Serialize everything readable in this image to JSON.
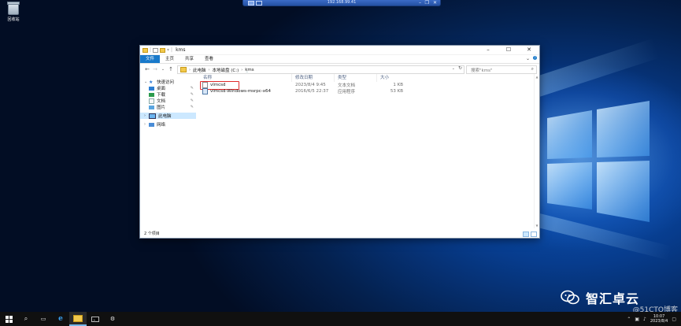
{
  "rdp": {
    "host": "192.168.99.41"
  },
  "desktop": {
    "recycle_bin_label": "回收站"
  },
  "explorer": {
    "title": "kms",
    "ribbon_tabs": [
      "文件",
      "主页",
      "共享",
      "查看"
    ],
    "address": {
      "crumbs": [
        "此电脑",
        "本地磁盘 (C:)",
        "kms"
      ]
    },
    "search_placeholder": "搜索\"kms\"",
    "nav": {
      "quick_access": "快速访问",
      "items": [
        {
          "label": "桌面",
          "icon": "desktop-icon"
        },
        {
          "label": "下载",
          "icon": "download-icon"
        },
        {
          "label": "文档",
          "icon": "document-icon"
        },
        {
          "label": "图片",
          "icon": "picture-icon"
        }
      ],
      "this_pc": "此电脑",
      "network": "网络"
    },
    "columns": {
      "name": "名称",
      "date": "修改日期",
      "type": "类型",
      "size": "大小"
    },
    "files": [
      {
        "name": "vlmcsd",
        "date": "2023/8/4 9:45",
        "type": "文本文档",
        "size": "1 KB",
        "icon": "text-file-icon",
        "highlighted": true
      },
      {
        "name": "vlmcsd-Windows-msrpc-x64",
        "date": "2016/6/5 22:37",
        "type": "应用程序",
        "size": "53 KB",
        "icon": "exe-file-icon",
        "highlighted": false
      }
    ],
    "status": "2 个项目"
  },
  "taskbar": {
    "time": "10:07",
    "date": "2023/8/4"
  },
  "watermarks": {
    "brand": "智汇卓云",
    "site": "@51CTO博客"
  },
  "colors": {
    "accent": "#1979ca",
    "highlight_box": "#e12a2a",
    "taskbar": "#101010"
  }
}
